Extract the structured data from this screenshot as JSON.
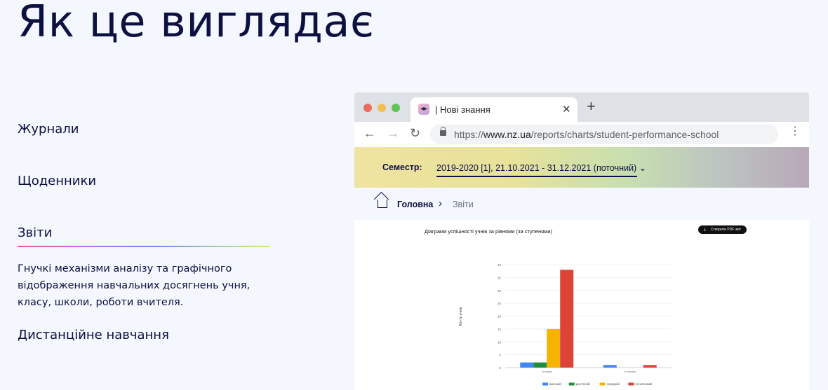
{
  "page": {
    "title": "Як це виглядає"
  },
  "menu": {
    "items": [
      {
        "label": "Журнали"
      },
      {
        "label": "Щоденники"
      },
      {
        "label": "Звіти"
      },
      {
        "label": "Дистанційне навчання"
      }
    ],
    "active_description": "Гнучкі механізми аналізу та графічного відображення навчальних досягнень учня, класу, школи, роботи вчителя."
  },
  "browser": {
    "tab_title": "| Нові знання",
    "tab_close": "✕",
    "new_tab": "+",
    "url_scheme": "https://",
    "url_host": "www.nz.ua",
    "url_path": "/reports/charts/student-performance-school",
    "icons": {
      "back": "←",
      "forward": "→",
      "reload": "↻",
      "menu": "⋮"
    }
  },
  "semester": {
    "label": "Семестр:",
    "value": "2019-2020 [1], 21.10.2021 - 31.12.2021 (поточний) ⌄"
  },
  "breadcrumb": {
    "home": "Головна",
    "separator": "›",
    "current": "Звіти"
  },
  "report": {
    "pdf_button": "Створити PDF звіт",
    "pdf_icon": "⤓"
  },
  "chart_data": {
    "type": "bar",
    "title": "Діаграми успішності учнів за рівнями (за ступенями)",
    "ylabel": "Кіл-ть учнів",
    "xlabel": "",
    "categories": [
      "І ступінь",
      "ІІ ступінь"
    ],
    "ylim": [
      0,
      40
    ],
    "yticks": [
      0,
      5,
      10,
      15,
      20,
      25,
      30,
      35,
      40
    ],
    "grid": true,
    "legend": "bottom",
    "series": [
      {
        "name": "високий",
        "color": "#4285f4",
        "values": [
          2,
          1
        ]
      },
      {
        "name": "достатній",
        "color": "#1e8e3e",
        "values": [
          2,
          0
        ]
      },
      {
        "name": "середній",
        "color": "#f4b400",
        "values": [
          15,
          0
        ]
      },
      {
        "name": "початковий",
        "color": "#db4437",
        "values": [
          38,
          1
        ]
      }
    ]
  }
}
